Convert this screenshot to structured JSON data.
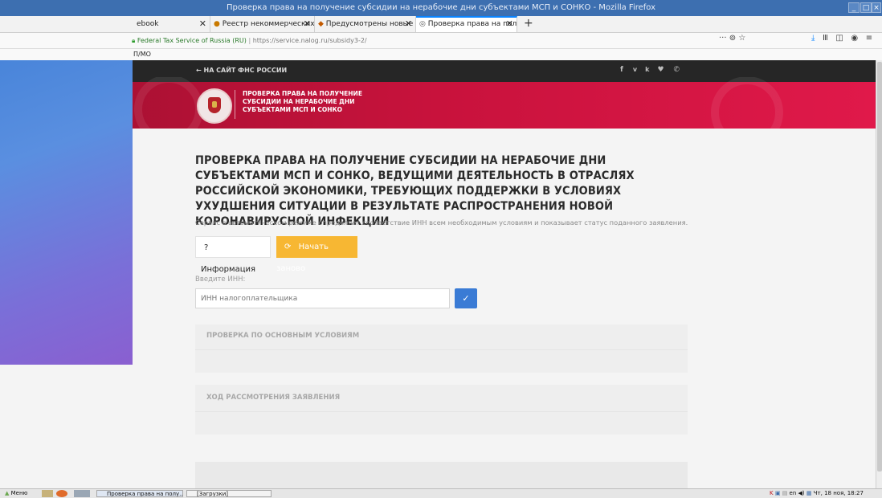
{
  "window": {
    "title": "Проверка права на получение субсидии на нерабочие дни субъектами МСП и СОНКО - Mozilla Firefox"
  },
  "tabs": [
    {
      "label": "ebook"
    },
    {
      "label": "Реестр некоммерческих ор"
    },
    {
      "label": "Предусмотрены новые мер"
    },
    {
      "label": "Проверка права на получе"
    }
  ],
  "navbar": {
    "identity": "Federal Tax Service of Russia (RU)",
    "url": "https://service.nalog.ru/subsidy3-2/",
    "more": "···"
  },
  "bookmarks": {
    "item": "П/МО"
  },
  "site": {
    "back_link": "НА САЙТ ФНС РОССИИ",
    "social": [
      "f",
      "vk",
      "tw",
      "ph"
    ],
    "hero_title_1": "ПРОВЕРКА ПРАВА НА ПОЛУЧЕНИЕ",
    "hero_title_2": "СУБСИДИИ НА НЕРАБОЧИЕ ДНИ",
    "hero_title_3": "СУБЪЕКТАМИ МСП И СОНКО",
    "main_heading": "ПРОВЕРКА ПРАВА НА ПОЛУЧЕНИЕ СУБСИДИИ НА НЕРАБОЧИЕ ДНИ СУБЪЕКТАМИ МСП И СОНКО, ВЕДУЩИМИ ДЕЯТЕЛЬНОСТЬ В ОТРАСЛЯХ РОССИЙСКОЙ ЭКОНОМИКИ, ТРЕБУЮЩИХ ПОДДЕРЖКИ В УСЛОВИЯХ УХУДШЕНИЯ СИТУАЦИИ В РЕЗУЛЬТАТЕ РАСПРОСТРАНЕНИЯ НОВОЙ КОРОНАВИРУСНОЙ ИНФЕКЦИИ",
    "description": "Сервис в автоматическом режиме определяет соответствие ИНН всем необходимым условиям и показывает статус поданного заявления.",
    "info_button": "Информация",
    "restart_button": "Начать заново",
    "inn_label": "Введите ИНН:",
    "inn_placeholder": "ИНН налогоплательщика",
    "section1": "ПРОВЕРКА ПО ОСНОВНЫМ УСЛОВИЯМ",
    "section2": "ХОД РАССМОТРЕНИЯ ЗАЯВЛЕНИЯ"
  },
  "taskbar": {
    "menu": "Меню",
    "task1": "Проверка права на полу...",
    "task2": "[Загрузки]",
    "lang": "en",
    "clock": "Чт, 18 ноя, 18:27"
  },
  "colors": {
    "accent_blue": "#3a7bd5",
    "restart_orange": "#f7b733",
    "hero_red": "#d0143f"
  }
}
